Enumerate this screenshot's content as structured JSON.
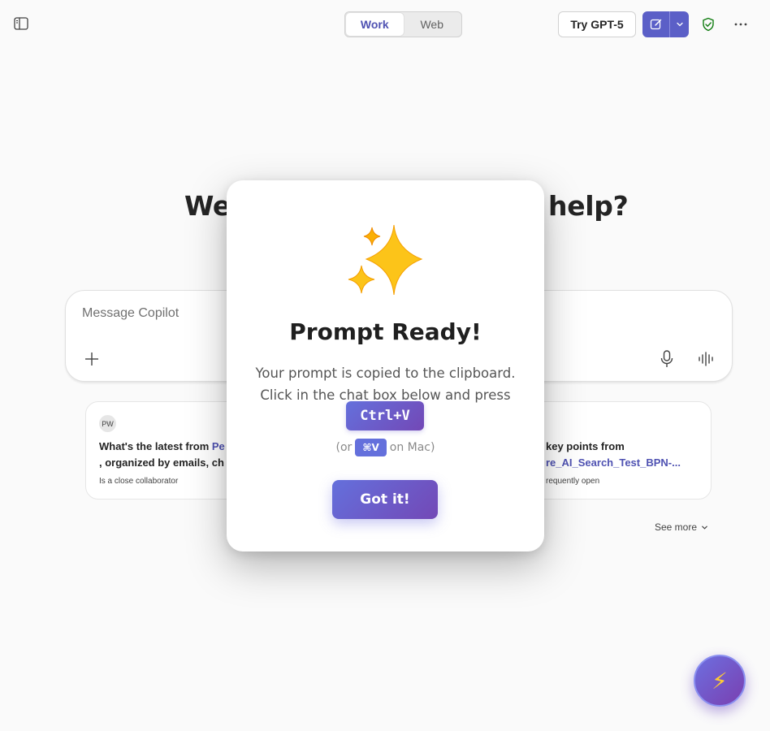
{
  "header": {
    "tabs": [
      {
        "label": "Work",
        "active": true
      },
      {
        "label": "Web",
        "active": false
      }
    ],
    "try_label": "Try GPT-5",
    "icons": {
      "sidebar": "sidebar-toggle-icon",
      "new_chat": "compose-icon",
      "dropdown": "chevron-down-icon",
      "shield": "shield-check-icon",
      "more": "more-horizontal-icon"
    }
  },
  "main": {
    "headline_left": "We",
    "headline_right": "help?",
    "composer_placeholder": "Message Copilot",
    "cards": [
      {
        "avatar": "PW",
        "text_prefix": "What's the latest from ",
        "text_link": "Pe",
        "text_line2": ", organized by emails, ch",
        "subtitle": "Is a close collaborator"
      },
      {
        "text_line1": "key points from",
        "text_link": "re_AI_Search_Test_BPN-...",
        "subtitle": "requently open"
      }
    ],
    "see_more": "See more"
  },
  "modal": {
    "emoji": "✨",
    "title": "Prompt Ready!",
    "body_line1": "Your prompt is copied to the clipboard.",
    "body_line2": "Click in the chat box below and press",
    "shortcut": "Ctrl+V",
    "mac_prefix": "(or",
    "mac_shortcut": "⌘V",
    "mac_suffix": "on Mac)",
    "confirm_label": "Got it!"
  },
  "fab": {
    "icon": "⚡"
  },
  "colors": {
    "accent": "#5b5fc7",
    "gradient_start": "#6470dc",
    "gradient_end": "#7348b6",
    "link": "#4f52b2",
    "shield": "#107c10"
  }
}
